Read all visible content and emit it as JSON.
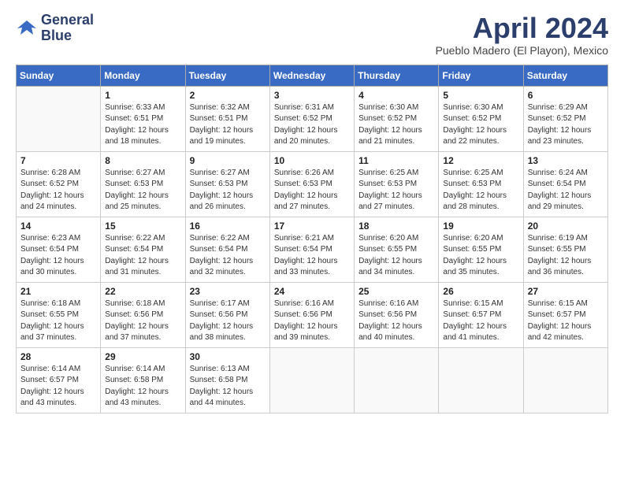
{
  "header": {
    "logo_line1": "General",
    "logo_line2": "Blue",
    "month_title": "April 2024",
    "subtitle": "Pueblo Madero (El Playon), Mexico"
  },
  "calendar": {
    "days_of_week": [
      "Sunday",
      "Monday",
      "Tuesday",
      "Wednesday",
      "Thursday",
      "Friday",
      "Saturday"
    ],
    "weeks": [
      [
        {
          "day": "",
          "empty": true
        },
        {
          "day": "1",
          "sunrise": "6:33 AM",
          "sunset": "6:51 PM",
          "daylight": "12 hours and 18 minutes."
        },
        {
          "day": "2",
          "sunrise": "6:32 AM",
          "sunset": "6:51 PM",
          "daylight": "12 hours and 19 minutes."
        },
        {
          "day": "3",
          "sunrise": "6:31 AM",
          "sunset": "6:52 PM",
          "daylight": "12 hours and 20 minutes."
        },
        {
          "day": "4",
          "sunrise": "6:30 AM",
          "sunset": "6:52 PM",
          "daylight": "12 hours and 21 minutes."
        },
        {
          "day": "5",
          "sunrise": "6:30 AM",
          "sunset": "6:52 PM",
          "daylight": "12 hours and 22 minutes."
        },
        {
          "day": "6",
          "sunrise": "6:29 AM",
          "sunset": "6:52 PM",
          "daylight": "12 hours and 23 minutes."
        }
      ],
      [
        {
          "day": "7",
          "sunrise": "6:28 AM",
          "sunset": "6:52 PM",
          "daylight": "12 hours and 24 minutes."
        },
        {
          "day": "8",
          "sunrise": "6:27 AM",
          "sunset": "6:53 PM",
          "daylight": "12 hours and 25 minutes."
        },
        {
          "day": "9",
          "sunrise": "6:27 AM",
          "sunset": "6:53 PM",
          "daylight": "12 hours and 26 minutes."
        },
        {
          "day": "10",
          "sunrise": "6:26 AM",
          "sunset": "6:53 PM",
          "daylight": "12 hours and 27 minutes."
        },
        {
          "day": "11",
          "sunrise": "6:25 AM",
          "sunset": "6:53 PM",
          "daylight": "12 hours and 27 minutes."
        },
        {
          "day": "12",
          "sunrise": "6:25 AM",
          "sunset": "6:53 PM",
          "daylight": "12 hours and 28 minutes."
        },
        {
          "day": "13",
          "sunrise": "6:24 AM",
          "sunset": "6:54 PM",
          "daylight": "12 hours and 29 minutes."
        }
      ],
      [
        {
          "day": "14",
          "sunrise": "6:23 AM",
          "sunset": "6:54 PM",
          "daylight": "12 hours and 30 minutes."
        },
        {
          "day": "15",
          "sunrise": "6:22 AM",
          "sunset": "6:54 PM",
          "daylight": "12 hours and 31 minutes."
        },
        {
          "day": "16",
          "sunrise": "6:22 AM",
          "sunset": "6:54 PM",
          "daylight": "12 hours and 32 minutes."
        },
        {
          "day": "17",
          "sunrise": "6:21 AM",
          "sunset": "6:54 PM",
          "daylight": "12 hours and 33 minutes."
        },
        {
          "day": "18",
          "sunrise": "6:20 AM",
          "sunset": "6:55 PM",
          "daylight": "12 hours and 34 minutes."
        },
        {
          "day": "19",
          "sunrise": "6:20 AM",
          "sunset": "6:55 PM",
          "daylight": "12 hours and 35 minutes."
        },
        {
          "day": "20",
          "sunrise": "6:19 AM",
          "sunset": "6:55 PM",
          "daylight": "12 hours and 36 minutes."
        }
      ],
      [
        {
          "day": "21",
          "sunrise": "6:18 AM",
          "sunset": "6:55 PM",
          "daylight": "12 hours and 37 minutes."
        },
        {
          "day": "22",
          "sunrise": "6:18 AM",
          "sunset": "6:56 PM",
          "daylight": "12 hours and 37 minutes."
        },
        {
          "day": "23",
          "sunrise": "6:17 AM",
          "sunset": "6:56 PM",
          "daylight": "12 hours and 38 minutes."
        },
        {
          "day": "24",
          "sunrise": "6:16 AM",
          "sunset": "6:56 PM",
          "daylight": "12 hours and 39 minutes."
        },
        {
          "day": "25",
          "sunrise": "6:16 AM",
          "sunset": "6:56 PM",
          "daylight": "12 hours and 40 minutes."
        },
        {
          "day": "26",
          "sunrise": "6:15 AM",
          "sunset": "6:57 PM",
          "daylight": "12 hours and 41 minutes."
        },
        {
          "day": "27",
          "sunrise": "6:15 AM",
          "sunset": "6:57 PM",
          "daylight": "12 hours and 42 minutes."
        }
      ],
      [
        {
          "day": "28",
          "sunrise": "6:14 AM",
          "sunset": "6:57 PM",
          "daylight": "12 hours and 43 minutes."
        },
        {
          "day": "29",
          "sunrise": "6:14 AM",
          "sunset": "6:58 PM",
          "daylight": "12 hours and 43 minutes."
        },
        {
          "day": "30",
          "sunrise": "6:13 AM",
          "sunset": "6:58 PM",
          "daylight": "12 hours and 44 minutes."
        },
        {
          "day": "",
          "empty": true
        },
        {
          "day": "",
          "empty": true
        },
        {
          "day": "",
          "empty": true
        },
        {
          "day": "",
          "empty": true
        }
      ]
    ]
  }
}
